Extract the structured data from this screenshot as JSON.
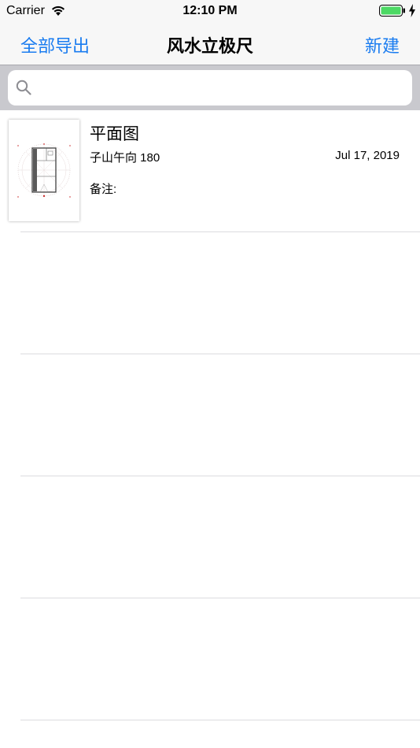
{
  "status_bar": {
    "carrier": "Carrier",
    "time": "12:10 PM",
    "battery_color": "#4cd964"
  },
  "nav": {
    "left_label": "全部导出",
    "title": "风水立极尺",
    "right_label": "新建",
    "accent_color": "#1a7cf0"
  },
  "search": {
    "placeholder": "",
    "value": ""
  },
  "records": [
    {
      "title": "平面图",
      "direction": "子山午向 180",
      "date": "Jul 17, 2019",
      "note": "备注:"
    }
  ]
}
